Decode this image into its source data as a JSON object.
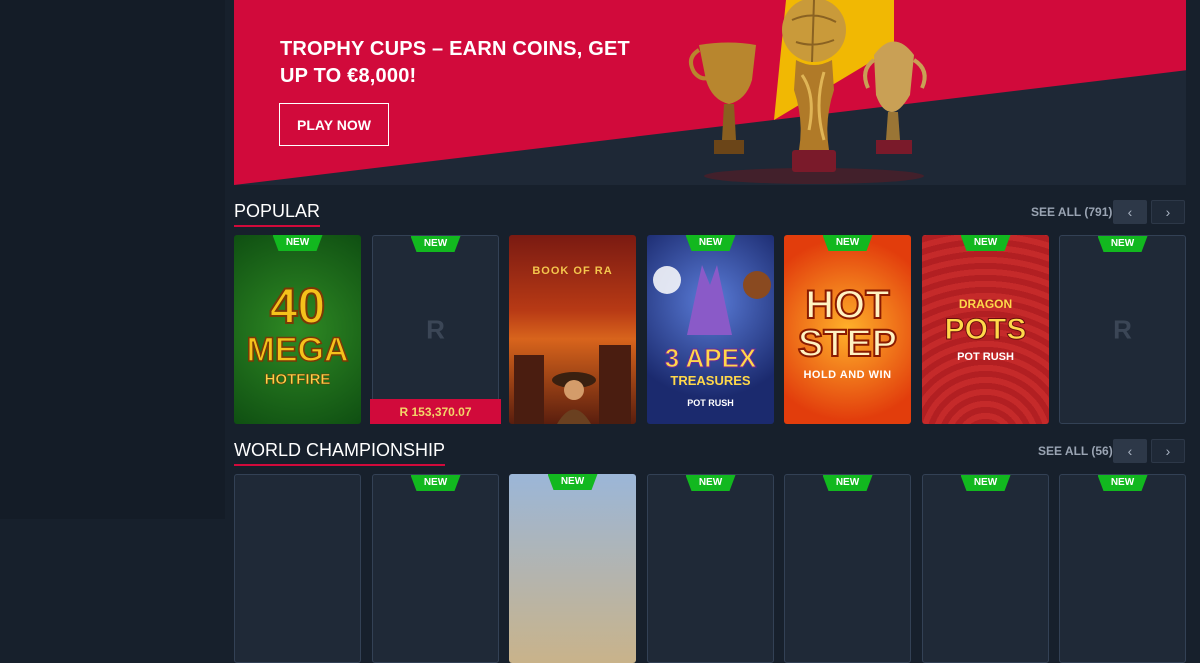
{
  "banner": {
    "title": "TROPHY CUPS – EARN COINS, GET UP TO €8,000!",
    "cta_label": "PLAY NOW"
  },
  "sections": [
    {
      "title": "POPULAR",
      "see_all": "SEE ALL (791)",
      "cards": [
        {
          "badge": "NEW",
          "art": "40 MEGA HOTFIRE"
        },
        {
          "badge": "NEW",
          "placeholder": "R",
          "jackpot": "R 153,370.07"
        },
        {
          "art": "BOOK OF RA"
        },
        {
          "badge": "NEW",
          "art": "3 APEX TREASURES POT RUSH"
        },
        {
          "badge": "NEW",
          "art": "HOT STEP HOLD AND WIN"
        },
        {
          "badge": "NEW",
          "art": "DRAGON POTS POT RUSH"
        },
        {
          "badge": "NEW",
          "placeholder": "R"
        }
      ]
    },
    {
      "title": "WORLD CHAMPIONSHIP",
      "see_all": "SEE ALL (56)",
      "badges": [
        "NEW",
        "NEW",
        "NEW",
        "NEW",
        "NEW",
        "NEW"
      ]
    }
  ],
  "icons": {
    "prev": "chevron-left-icon",
    "next": "chevron-right-icon"
  },
  "colors": {
    "accent": "#d10a3b",
    "new_badge": "#12b81f",
    "background": "#17202c"
  }
}
